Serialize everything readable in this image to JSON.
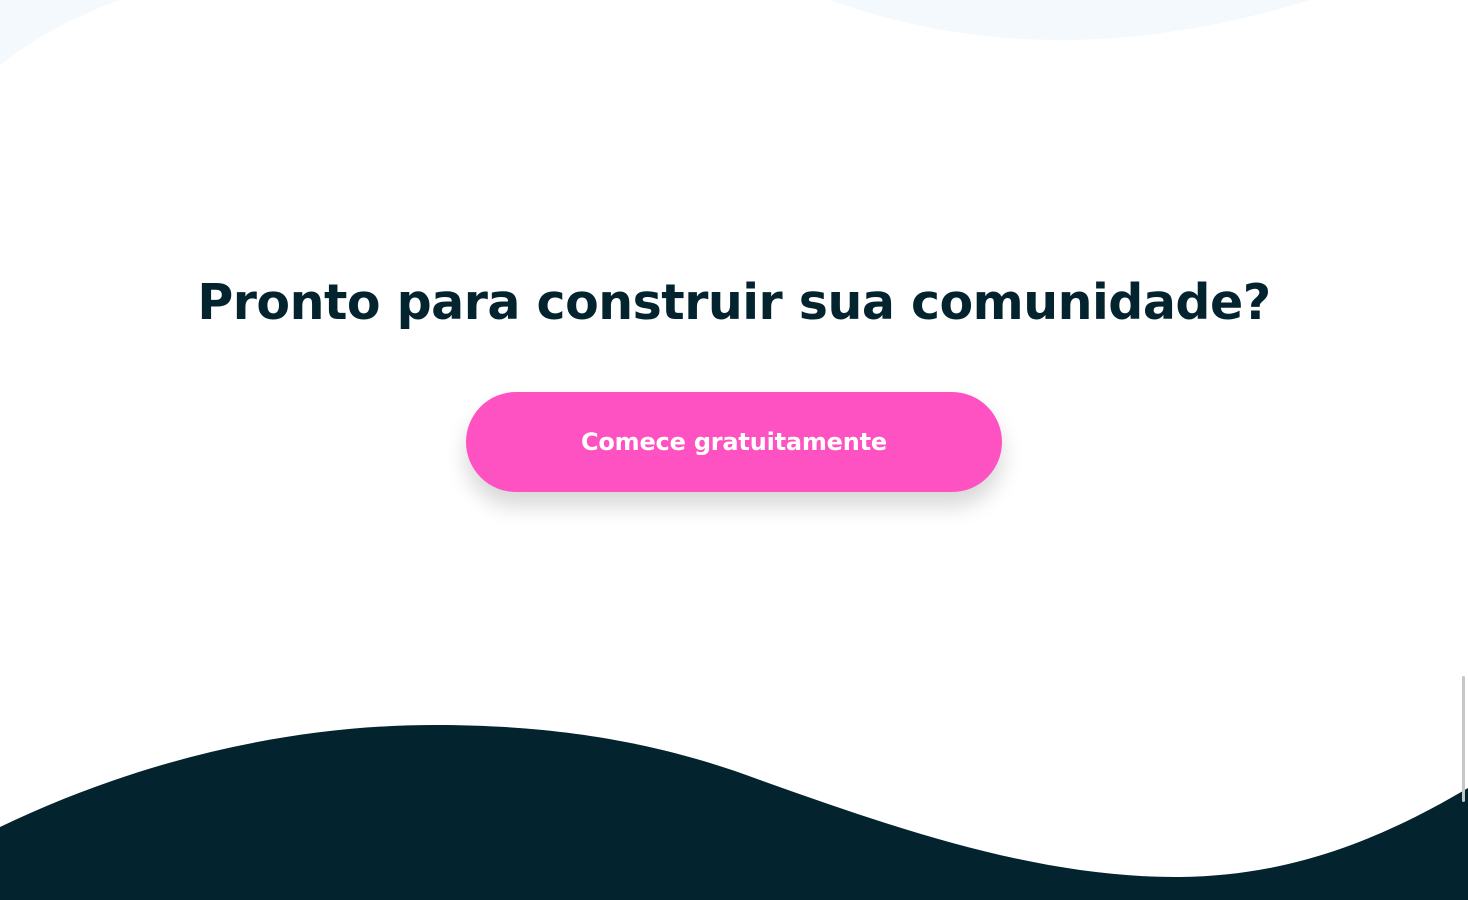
{
  "cta_section": {
    "headline": "Pronto para construir sua comunidade?",
    "button_label": "Comece gratuitamente"
  },
  "colors": {
    "background": "#ffffff",
    "top_wave": "#f4f9fe",
    "headline_text": "#03232e",
    "button_background": "#ff52c2",
    "button_text": "#ffffff",
    "footer_wave": "#03232e"
  }
}
